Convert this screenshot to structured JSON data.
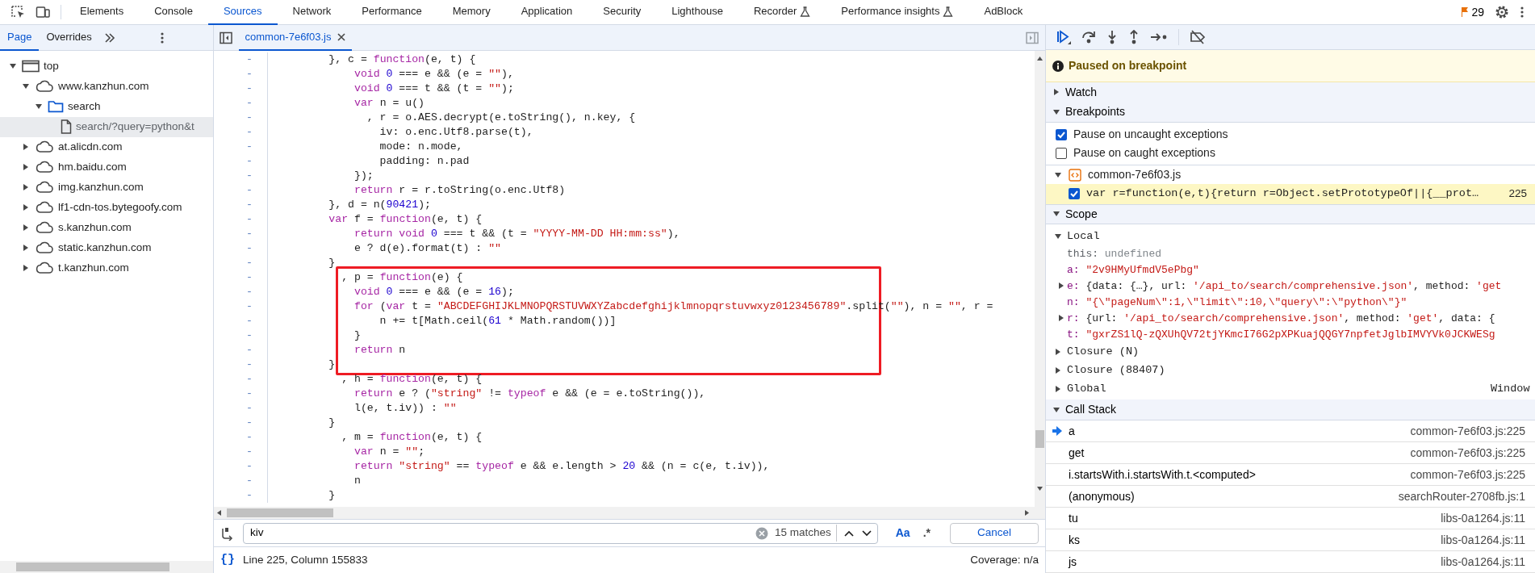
{
  "toolbar": {
    "tabs": [
      {
        "label": "Elements",
        "selected": false,
        "experimental": false
      },
      {
        "label": "Console",
        "selected": false,
        "experimental": false
      },
      {
        "label": "Sources",
        "selected": true,
        "experimental": false
      },
      {
        "label": "Network",
        "selected": false,
        "experimental": false
      },
      {
        "label": "Performance",
        "selected": false,
        "experimental": false
      },
      {
        "label": "Memory",
        "selected": false,
        "experimental": false
      },
      {
        "label": "Application",
        "selected": false,
        "experimental": false
      },
      {
        "label": "Security",
        "selected": false,
        "experimental": false
      },
      {
        "label": "Lighthouse",
        "selected": false,
        "experimental": false
      },
      {
        "label": "Recorder",
        "selected": false,
        "experimental": true
      },
      {
        "label": "Performance insights",
        "selected": false,
        "experimental": true
      },
      {
        "label": "AdBlock",
        "selected": false,
        "experimental": false
      }
    ],
    "issues_count": "29"
  },
  "navigator": {
    "tabs": [
      {
        "label": "Page",
        "selected": true
      },
      {
        "label": "Overrides",
        "selected": false
      }
    ],
    "tree": [
      {
        "label": "top",
        "kind": "frame",
        "expanded": true,
        "selected": false,
        "children": [
          {
            "label": "www.kanzhun.com",
            "kind": "domain",
            "expanded": true,
            "selected": false,
            "children": [
              {
                "label": "search",
                "kind": "folder",
                "expanded": true,
                "selected": false,
                "children": [
                  {
                    "label": "search/?query=python&t",
                    "kind": "file",
                    "selected": true
                  }
                ]
              }
            ]
          },
          {
            "label": "at.alicdn.com",
            "kind": "domain",
            "expanded": false,
            "selected": false
          },
          {
            "label": "hm.baidu.com",
            "kind": "domain",
            "expanded": false,
            "selected": false
          },
          {
            "label": "img.kanzhun.com",
            "kind": "domain",
            "expanded": false,
            "selected": false
          },
          {
            "label": "lf1-cdn-tos.bytegoofy.com",
            "kind": "domain",
            "expanded": false,
            "selected": false
          },
          {
            "label": "s.kanzhun.com",
            "kind": "domain",
            "expanded": false,
            "selected": false
          },
          {
            "label": "static.kanzhun.com",
            "kind": "domain",
            "expanded": false,
            "selected": false
          },
          {
            "label": "t.kanzhun.com",
            "kind": "domain",
            "expanded": false,
            "selected": false
          }
        ]
      }
    ]
  },
  "editor": {
    "tabs": [
      {
        "label": "common-7e6f03.js",
        "selected": true
      }
    ],
    "blocks": [
      {
        "highlighted": false,
        "lines": [
          {
            "marker": "-",
            "tokens": [
              {
                "kind": "plain",
                "text": "        }, c = "
              },
              {
                "kind": "keyword",
                "text": "function"
              },
              {
                "kind": "plain",
                "text": "(e, t) {"
              }
            ]
          },
          {
            "marker": "-",
            "tokens": [
              {
                "kind": "keyword",
                "text": "            void"
              },
              {
                "kind": "number",
                "text": " 0"
              },
              {
                "kind": "plain",
                "text": " === e && (e = "
              },
              {
                "kind": "string",
                "text": "\"\""
              },
              {
                "kind": "plain",
                "text": "),"
              }
            ]
          },
          {
            "marker": "-",
            "tokens": [
              {
                "kind": "keyword",
                "text": "            void"
              },
              {
                "kind": "number",
                "text": " 0"
              },
              {
                "kind": "plain",
                "text": " === t && (t = "
              },
              {
                "kind": "string",
                "text": "\"\""
              },
              {
                "kind": "plain",
                "text": ");"
              }
            ]
          },
          {
            "marker": "-",
            "tokens": [
              {
                "kind": "keyword",
                "text": "            var"
              },
              {
                "kind": "plain",
                "text": " n = u()"
              }
            ]
          },
          {
            "marker": "-",
            "tokens": [
              {
                "kind": "plain",
                "text": "              , r = o.AES.decrypt(e.toString(), n.key, {"
              }
            ]
          },
          {
            "marker": "-",
            "tokens": [
              {
                "kind": "plain",
                "text": "                iv: o.enc.Utf8.parse(t),"
              }
            ]
          },
          {
            "marker": "-",
            "tokens": [
              {
                "kind": "plain",
                "text": "                mode: n.mode,"
              }
            ]
          },
          {
            "marker": "-",
            "tokens": [
              {
                "kind": "plain",
                "text": "                padding: n.pad"
              }
            ]
          },
          {
            "marker": "-",
            "tokens": [
              {
                "kind": "plain",
                "text": "            });"
              }
            ]
          },
          {
            "marker": "-",
            "tokens": [
              {
                "kind": "keyword",
                "text": "            return"
              },
              {
                "kind": "plain",
                "text": " r = r.toString(o.enc.Utf8)"
              }
            ]
          },
          {
            "marker": "-",
            "tokens": [
              {
                "kind": "plain",
                "text": "        }, d = n("
              },
              {
                "kind": "number",
                "text": "90421"
              },
              {
                "kind": "plain",
                "text": ");"
              }
            ]
          },
          {
            "marker": "-",
            "tokens": [
              {
                "kind": "keyword",
                "text": "        var"
              },
              {
                "kind": "plain",
                "text": " f = "
              },
              {
                "kind": "keyword",
                "text": "function"
              },
              {
                "kind": "plain",
                "text": "(e, t) {"
              }
            ]
          },
          {
            "marker": "-",
            "tokens": [
              {
                "kind": "keyword",
                "text": "            return"
              },
              {
                "kind": "keyword",
                "text": " void"
              },
              {
                "kind": "number",
                "text": " 0"
              },
              {
                "kind": "plain",
                "text": " === t && (t = "
              },
              {
                "kind": "string",
                "text": "\"YYYY-MM-DD HH:mm:ss\""
              },
              {
                "kind": "plain",
                "text": "),"
              }
            ]
          },
          {
            "marker": "-",
            "tokens": [
              {
                "kind": "plain",
                "text": "            e ? d(e).format(t) : "
              },
              {
                "kind": "string",
                "text": "\"\""
              }
            ]
          },
          {
            "marker": "-",
            "tokens": [
              {
                "kind": "plain",
                "text": "        }"
              }
            ]
          }
        ]
      },
      {
        "highlighted": true,
        "lines": [
          {
            "marker": "-",
            "tokens": [
              {
                "kind": "plain",
                "text": "          , p = "
              },
              {
                "kind": "keyword",
                "text": "function"
              },
              {
                "kind": "plain",
                "text": "(e) {"
              }
            ]
          },
          {
            "marker": "-",
            "tokens": [
              {
                "kind": "keyword",
                "text": "            void"
              },
              {
                "kind": "number",
                "text": " 0"
              },
              {
                "kind": "plain",
                "text": " === e && (e = "
              },
              {
                "kind": "number",
                "text": "16"
              },
              {
                "kind": "plain",
                "text": ");"
              }
            ]
          },
          {
            "marker": "-",
            "tokens": [
              {
                "kind": "keyword",
                "text": "            for"
              },
              {
                "kind": "plain",
                "text": " ("
              },
              {
                "kind": "keyword",
                "text": "var"
              },
              {
                "kind": "plain",
                "text": " t = "
              },
              {
                "kind": "string",
                "text": "\"ABCDEFGHIJKLMNOPQRSTUVWXYZabcdefghijklmnopqrstuvwxyz0123456789\""
              },
              {
                "kind": "plain",
                "text": ".split("
              },
              {
                "kind": "string",
                "text": "\"\""
              },
              {
                "kind": "plain",
                "text": "), n = "
              },
              {
                "kind": "string",
                "text": "\"\""
              },
              {
                "kind": "plain",
                "text": ", r ="
              }
            ]
          },
          {
            "marker": "-",
            "tokens": [
              {
                "kind": "plain",
                "text": "                n += t[Math.ceil("
              },
              {
                "kind": "number",
                "text": "61"
              },
              {
                "kind": "plain",
                "text": " * Math.random())]"
              }
            ]
          },
          {
            "marker": "-",
            "tokens": [
              {
                "kind": "plain",
                "text": "            }"
              }
            ]
          },
          {
            "marker": "-",
            "tokens": [
              {
                "kind": "keyword",
                "text": "            return"
              },
              {
                "kind": "plain",
                "text": " n"
              }
            ]
          },
          {
            "marker": "-",
            "tokens": [
              {
                "kind": "plain",
                "text": "        }"
              }
            ]
          }
        ]
      },
      {
        "highlighted": false,
        "lines": [
          {
            "marker": "-",
            "tokens": [
              {
                "kind": "plain",
                "text": "          , h = "
              },
              {
                "kind": "keyword",
                "text": "function"
              },
              {
                "kind": "plain",
                "text": "(e, t) {"
              }
            ]
          },
          {
            "marker": "-",
            "tokens": [
              {
                "kind": "keyword",
                "text": "            return"
              },
              {
                "kind": "plain",
                "text": " e ? ("
              },
              {
                "kind": "string",
                "text": "\"string\""
              },
              {
                "kind": "plain",
                "text": " != "
              },
              {
                "kind": "keyword",
                "text": "typeof"
              },
              {
                "kind": "plain",
                "text": " e && (e = e.toString()),"
              }
            ]
          },
          {
            "marker": "-",
            "tokens": [
              {
                "kind": "plain",
                "text": "            l(e, t.iv)) : "
              },
              {
                "kind": "string",
                "text": "\"\""
              }
            ]
          },
          {
            "marker": "-",
            "tokens": [
              {
                "kind": "plain",
                "text": "        }"
              }
            ]
          },
          {
            "marker": "-",
            "tokens": [
              {
                "kind": "plain",
                "text": "          , m = "
              },
              {
                "kind": "keyword",
                "text": "function"
              },
              {
                "kind": "plain",
                "text": "(e, t) {"
              }
            ]
          },
          {
            "marker": "-",
            "tokens": [
              {
                "kind": "keyword",
                "text": "            var"
              },
              {
                "kind": "plain",
                "text": " n = "
              },
              {
                "kind": "string",
                "text": "\"\""
              },
              {
                "kind": "plain",
                "text": ";"
              }
            ]
          },
          {
            "marker": "-",
            "tokens": [
              {
                "kind": "keyword",
                "text": "            return"
              },
              {
                "kind": "string",
                "text": " \"string\""
              },
              {
                "kind": "plain",
                "text": " == "
              },
              {
                "kind": "keyword",
                "text": "typeof"
              },
              {
                "kind": "plain",
                "text": " e && e.length > "
              },
              {
                "kind": "number",
                "text": "20"
              },
              {
                "kind": "plain",
                "text": " && (n = c(e, t.iv)),"
              }
            ]
          },
          {
            "marker": "-",
            "tokens": [
              {
                "kind": "plain",
                "text": "            n"
              }
            ]
          },
          {
            "marker": "-",
            "tokens": [
              {
                "kind": "plain",
                "text": "        }"
              }
            ]
          }
        ]
      }
    ],
    "search": {
      "value": "kiv",
      "matches": "15 matches",
      "match_case": true,
      "regex": false,
      "match_case_label": "Aa",
      "regex_label": ".*",
      "cancel": "Cancel"
    },
    "status": {
      "pretty_print": "{}",
      "position": "Line 225, Column 155833",
      "coverage": "Coverage: n/a"
    }
  },
  "debugger": {
    "banner": "Paused on breakpoint",
    "watch": {
      "label": "Watch",
      "expanded": false
    },
    "breakpoints": {
      "label": "Breakpoints",
      "expanded": true,
      "options": [
        {
          "label": "Pause on uncaught exceptions",
          "checked": true
        },
        {
          "label": "Pause on caught exceptions",
          "checked": false
        }
      ],
      "files": [
        {
          "name": "common-7e6f03.js",
          "expanded": true,
          "items": [
            {
              "code": "var r=function(e,t){return r=Object.setPrototypeOf||{__prot…",
              "line": "225",
              "checked": true,
              "selected": true
            }
          ]
        }
      ]
    },
    "scope": {
      "label": "Scope",
      "expanded": true,
      "groups": [
        {
          "label": "Local",
          "expanded": true,
          "vars": [
            {
              "name": "this:",
              "kind": "plain",
              "tokens": [
                {
                  "kind": "undefined",
                  "text": " undefined"
                }
              ]
            },
            {
              "name": "a:",
              "kind": "plain",
              "tokens": [
                {
                  "kind": "string",
                  "text": " \"2v9HMyUfmdV5ePbg\""
                }
              ]
            },
            {
              "name": "e:",
              "kind": "object",
              "expanded": false,
              "tokens": [
                {
                  "kind": "plain",
                  "text": " {data: {…}, url: "
                },
                {
                  "kind": "string",
                  "text": "'/api_to/search/comprehensive.json'"
                },
                {
                  "kind": "plain",
                  "text": ", method: "
                },
                {
                  "kind": "string",
                  "text": "'get"
                }
              ]
            },
            {
              "name": "n:",
              "kind": "plain",
              "tokens": [
                {
                  "kind": "string",
                  "text": " \"{\\\"pageNum\\\":1,\\\"limit\\\":10,\\\"query\\\":\\\"python\\\"}\""
                }
              ]
            },
            {
              "name": "r:",
              "kind": "object",
              "expanded": false,
              "tokens": [
                {
                  "kind": "plain",
                  "text": " {url: "
                },
                {
                  "kind": "string",
                  "text": "'/api_to/search/comprehensive.json'"
                },
                {
                  "kind": "plain",
                  "text": ", method: "
                },
                {
                  "kind": "string",
                  "text": "'get'"
                },
                {
                  "kind": "plain",
                  "text": ", data: {"
                }
              ]
            },
            {
              "name": "t:",
              "kind": "plain",
              "tokens": [
                {
                  "kind": "string",
                  "text": " \"gxrZS1lQ-zQXUhQV72tjYKmcI76G2pXPKuajQQGY7npfetJglbIMVYVk0JCKWESg"
                }
              ]
            }
          ]
        },
        {
          "label": "Closure (N)",
          "expanded": false
        },
        {
          "label": "Closure (88407)",
          "expanded": false
        },
        {
          "label": "Global",
          "expanded": false,
          "value": "Window"
        }
      ]
    },
    "call_stack": {
      "label": "Call Stack",
      "expanded": true,
      "frames": [
        {
          "name": "a",
          "location": "common-7e6f03.js:225",
          "current": true
        },
        {
          "name": "get",
          "location": "common-7e6f03.js:225",
          "current": false
        },
        {
          "name": "i.startsWith.i.startsWith.t.<computed>",
          "location": "common-7e6f03.js:225",
          "current": false
        },
        {
          "name": "(anonymous)",
          "location": "searchRouter-2708fb.js:1",
          "current": false
        },
        {
          "name": "tu",
          "location": "libs-0a1264.js:11",
          "current": false
        },
        {
          "name": "ks",
          "location": "libs-0a1264.js:11",
          "current": false
        },
        {
          "name": "js",
          "location": "libs-0a1264.js:11",
          "current": false
        }
      ]
    }
  }
}
